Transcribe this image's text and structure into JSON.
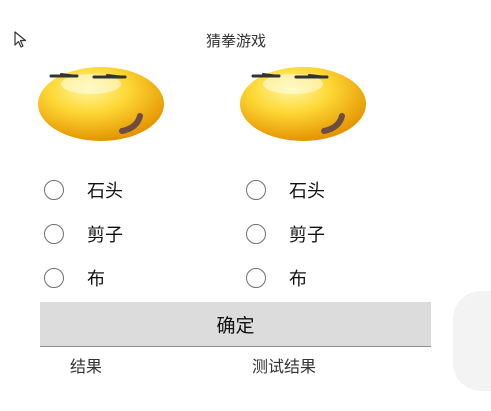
{
  "title": "猜拳游戏",
  "icons": {
    "cursor": "mouse-pointer-icon",
    "face": "smiley-emoticon-icon"
  },
  "player1": {
    "options": [
      {
        "label": "石头"
      },
      {
        "label": "剪子"
      },
      {
        "label": "布"
      }
    ]
  },
  "player2": {
    "options": [
      {
        "label": "石头"
      },
      {
        "label": "剪子"
      },
      {
        "label": "布"
      }
    ]
  },
  "confirm_button": "确定",
  "result": {
    "label": "结果",
    "value": "测试结果"
  },
  "colors": {
    "face_yellow": "#FDD835",
    "face_orange": "#E59400",
    "button_bg": "#DCDCDC"
  }
}
